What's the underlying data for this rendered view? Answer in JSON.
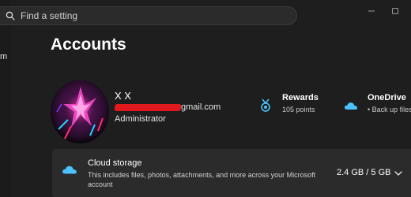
{
  "search": {
    "placeholder": "Find a setting"
  },
  "sidebar": {
    "fragment": "m"
  },
  "window_controls": {
    "minimize_icon": "minimize-icon",
    "maximize_icon": "maximize-icon"
  },
  "page": {
    "title": "Accounts"
  },
  "profile": {
    "name": "X X",
    "email_visible": "gmail.com",
    "role": "Administrator"
  },
  "tiles": {
    "rewards": {
      "title": "Rewards",
      "subtitle": "105 points",
      "icon": "rewards-medal-icon"
    },
    "onedrive": {
      "title": "OneDrive",
      "subtitle": "• Back up files",
      "icon": "onedrive-cloud-icon"
    }
  },
  "cloud_storage": {
    "title": "Cloud storage",
    "description": "This includes files, photos, attachments, and more across your Microsoft account",
    "usage": "2.4 GB / 5 GB",
    "icon": "cloud-icon"
  },
  "colors": {
    "background": "#1e1e1e",
    "card": "#2b2b2b",
    "accent_blue": "#4cc2ff",
    "redaction": "#e0191f"
  }
}
